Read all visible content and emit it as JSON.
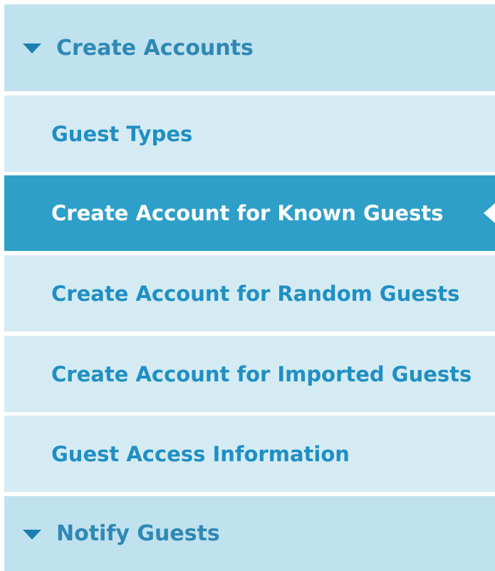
{
  "nav": {
    "sections": [
      {
        "label": "Create Accounts",
        "expanded": true,
        "items": [
          {
            "label": "Guest Types",
            "active": false
          },
          {
            "label": "Create Account for Known Guests",
            "active": true
          },
          {
            "label": "Create Account for Random Guests",
            "active": false
          },
          {
            "label": "Create Account for Imported Guests",
            "active": false
          },
          {
            "label": "Guest Access Information",
            "active": false
          }
        ]
      },
      {
        "label": "Notify Guests",
        "expanded": true,
        "items": []
      }
    ]
  },
  "colors": {
    "header_bg": "#c0e2ee",
    "item_bg": "#d5ebf3",
    "active_bg": "#2e9fc8",
    "link_text": "#1f8fc4",
    "active_text": "#ffffff",
    "caret": "#1d7fb0"
  },
  "icons": {
    "section_toggle": "caret-down-icon",
    "active_marker": "triangle-left-pointer"
  }
}
